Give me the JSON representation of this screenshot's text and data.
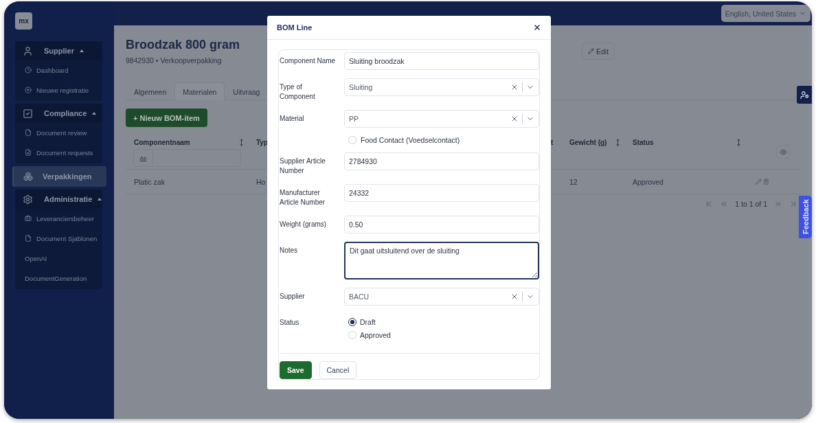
{
  "app": {
    "logo": "mx",
    "language": "English, United States"
  },
  "sidebar": [
    {
      "kind": "group",
      "label": "Supplier",
      "expanded": true,
      "items": [
        {
          "label": "Dashboard",
          "selected": false
        },
        {
          "label": "Nieuwe registratie",
          "selected": false
        }
      ]
    },
    {
      "kind": "group",
      "label": "Compliance",
      "expanded": true,
      "items": [
        {
          "label": "Document review",
          "selected": false
        },
        {
          "label": "Document requests",
          "selected": false
        }
      ]
    },
    {
      "kind": "link",
      "label": "Verpakkingen",
      "selected": true
    },
    {
      "kind": "group",
      "label": "Administratie",
      "expanded": true,
      "items": [
        {
          "label": "Leveranciersbeheer",
          "selected": false
        },
        {
          "label": "Document Sjablonen",
          "selected": false
        },
        {
          "label": "OpenAI",
          "selected": false
        },
        {
          "label": "DocumentGeneration",
          "selected": false
        }
      ]
    }
  ],
  "page": {
    "title": "Broodzak 800 gram",
    "subtitle": "9842930 • Verkoopverpakking",
    "edit_button": "Edit"
  },
  "tabs": [
    {
      "label": "Algemeen",
      "selected": false
    },
    {
      "label": "Materialen",
      "selected": true
    },
    {
      "label": "Uitvraag",
      "selected": false
    }
  ],
  "new_button": "+ Nieuw BOM-item",
  "table": {
    "columns": [
      {
        "label": "Componentnaam",
        "sortable": true,
        "filter_label": "Ab"
      },
      {
        "label": "Typ"
      },
      {
        "label": "t"
      },
      {
        "label": "Gewicht (g)",
        "sortable": true
      },
      {
        "label": "Status",
        "sortable": true
      }
    ],
    "rows": [
      {
        "componentnaam": "Platic zak",
        "typ": "Ho",
        "gewicht": "12",
        "status": "Approved"
      }
    ],
    "pagination": "1 to 1 of 1"
  },
  "dialog": {
    "title": "BOM Line",
    "fields": [
      {
        "kind": "text",
        "label": "Component Name",
        "value": "Sluiting broodzak"
      },
      {
        "kind": "select",
        "label": "Type of Component",
        "value": "Sluiting"
      },
      {
        "kind": "select",
        "label": "Material",
        "value": "PP"
      },
      {
        "kind": "checkbox",
        "label": "Food Contact (Voedselcontact)",
        "checked": false
      },
      {
        "kind": "text",
        "label": "Supplier Article Number",
        "value": "2784930"
      },
      {
        "kind": "text",
        "label": "Manufacturer Article Number",
        "value": "24332"
      },
      {
        "kind": "text",
        "label": "Weight (grams)",
        "value": "0.50"
      },
      {
        "kind": "textarea",
        "label": "Notes",
        "value": "Dit gaat uitsluitend over de sluiting",
        "focused": true
      },
      {
        "kind": "select",
        "label": "Supplier",
        "value": "BACU"
      },
      {
        "kind": "radio",
        "label": "Status",
        "options": [
          {
            "label": "Draft",
            "selected": true
          },
          {
            "label": "Approved",
            "selected": false
          }
        ]
      }
    ],
    "buttons": [
      {
        "label": "Save",
        "kind": "primary"
      },
      {
        "label": "Cancel",
        "kind": "secondary"
      }
    ]
  },
  "feedback": "Feedback"
}
